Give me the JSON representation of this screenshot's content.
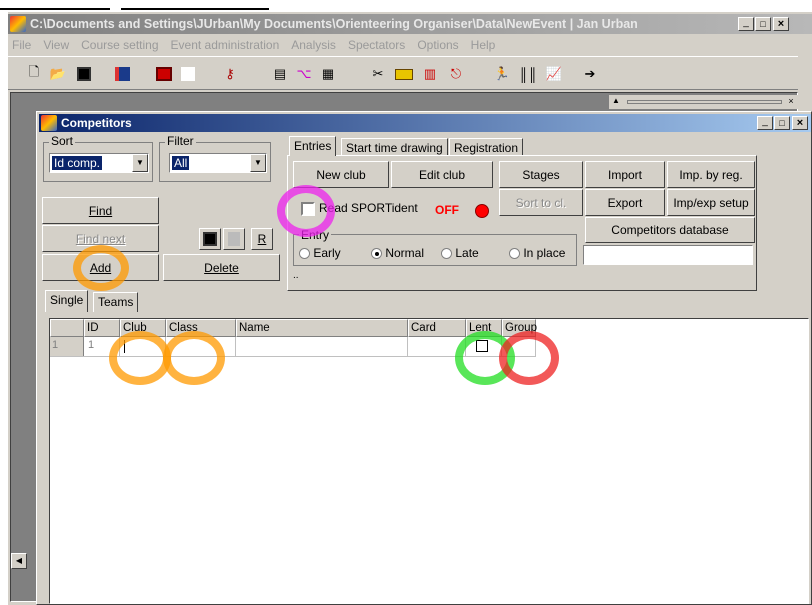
{
  "top_strip": {
    "text": ""
  },
  "main_window": {
    "title": "C:\\Documents and Settings\\JUrban\\My Documents\\Orienteering Organiser\\Data\\NewEvent | Jan Urban",
    "menu": [
      "File",
      "View",
      "Course setting",
      "Event administration",
      "Analysis",
      "Spectators",
      "Options",
      "Help"
    ],
    "toolbar_icons": [
      "new-file-icon",
      "open-folder-icon",
      "save-icon",
      "book-icon",
      "print-icon",
      "blank-icon",
      "key-icon",
      "list-icon",
      "tree-icon",
      "grid-icon",
      "tools-icon",
      "card-icon",
      "columns-icon",
      "exit-icon",
      "runner-icon",
      "barcode-icon",
      "graph-icon",
      "arrow-runner-icon"
    ]
  },
  "competitors": {
    "title": "Competitors",
    "sort_label": "Sort",
    "sort_value": "Id comp.",
    "filter_label": "Filter",
    "filter_value": "All",
    "find_label": "Find",
    "find_next_label": "Find next",
    "add_label": "Add",
    "delete_label": "Delete",
    "r_label": "R",
    "tabs": [
      "Entries",
      "Start time drawing",
      "Registration"
    ],
    "new_club_label": "New club",
    "edit_club_label": "Edit club",
    "read_sportident_label": "Read SPORTident",
    "off_label": "OFF",
    "entry_label": "Entry",
    "entry_options": [
      "Early",
      "Normal",
      "Late",
      "In place"
    ],
    "entry_selected": "Normal",
    "stages_label": "Stages",
    "sort_to_cl_label": "Sort to cl.",
    "import_label": "Import",
    "export_label": "Export",
    "imp_by_reg_label": "Imp. by reg.",
    "imp_exp_setup_label": "Imp/exp setup",
    "competitors_database_label": "Competitors database",
    "dots": "..",
    "grid_tabs": [
      "Single",
      "Teams"
    ],
    "columns": [
      "ID",
      "Club",
      "Class",
      "Name",
      "Card",
      "Lent",
      "Group"
    ],
    "rows": [
      {
        "row_no": "1",
        "id": "1",
        "club": "",
        "class": "",
        "name": "",
        "card": "",
        "lent": false,
        "group": ""
      }
    ]
  },
  "colors": {
    "title_active": "#0a246a",
    "title_inactive": "#808080",
    "highlight_orange": "#ff9900",
    "highlight_magenta": "#ee22ee",
    "highlight_green": "#22dd22",
    "highlight_red": "#ee2222",
    "off_red": "#ff0000"
  }
}
